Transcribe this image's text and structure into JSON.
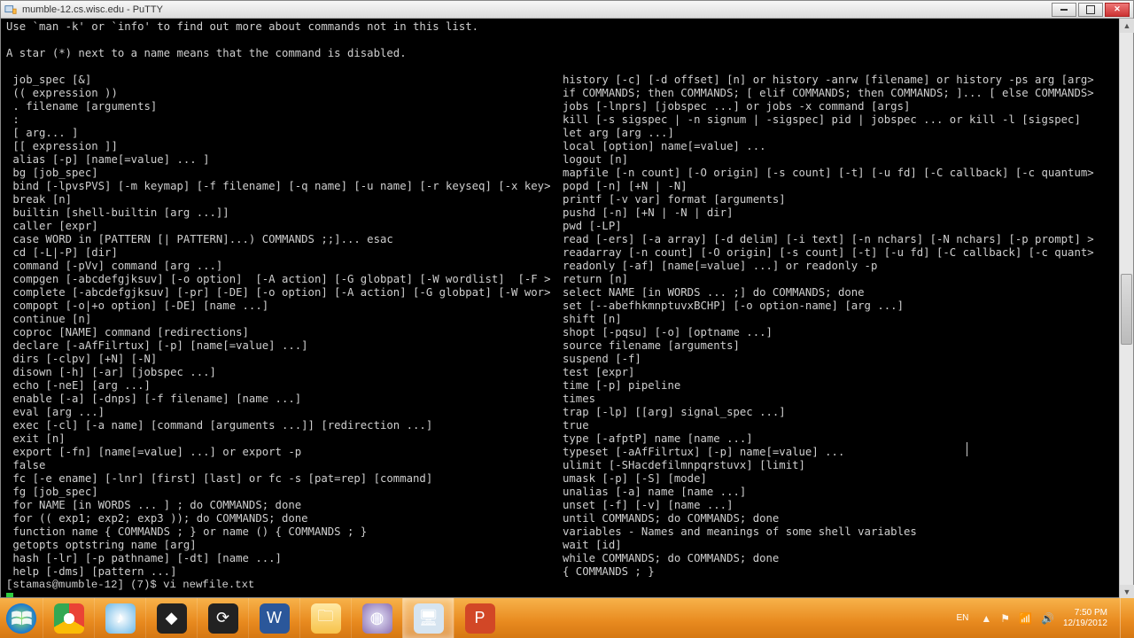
{
  "window": {
    "title": "mumble-12.cs.wisc.edu - PuTTY"
  },
  "terminal": {
    "intro": "Use `man -k' or `info' to find out more about commands not in this list.\n\nA star (*) next to a name means that the command is disabled.",
    "left_col": " job_spec [&]\n (( expression ))\n . filename [arguments]\n :\n [ arg... ]\n [[ expression ]]\n alias [-p] [name[=value] ... ]\n bg [job_spec]\n bind [-lpvsPVS] [-m keymap] [-f filename] [-q name] [-u name] [-r keyseq] [-x key>\n break [n]\n builtin [shell-builtin [arg ...]]\n caller [expr]\n case WORD in [PATTERN [| PATTERN]...) COMMANDS ;;]... esac\n cd [-L|-P] [dir]\n command [-pVv] command [arg ...]\n compgen [-abcdefgjksuv] [-o option]  [-A action] [-G globpat] [-W wordlist]  [-F >\n complete [-abcdefgjksuv] [-pr] [-DE] [-o option] [-A action] [-G globpat] [-W wor>\n compopt [-o|+o option] [-DE] [name ...]\n continue [n]\n coproc [NAME] command [redirections]\n declare [-aAfFilrtux] [-p] [name[=value] ...]\n dirs [-clpv] [+N] [-N]\n disown [-h] [-ar] [jobspec ...]\n echo [-neE] [arg ...]\n enable [-a] [-dnps] [-f filename] [name ...]\n eval [arg ...]\n exec [-cl] [-a name] [command [arguments ...]] [redirection ...]\n exit [n]\n export [-fn] [name[=value] ...] or export -p\n false\n fc [-e ename] [-lnr] [first] [last] or fc -s [pat=rep] [command]\n fg [job_spec]\n for NAME [in WORDS ... ] ; do COMMANDS; done\n for (( exp1; exp2; exp3 )); do COMMANDS; done\n function name { COMMANDS ; } or name () { COMMANDS ; }\n getopts optstring name [arg]\n hash [-lr] [-p pathname] [-dt] [name ...]\n help [-dms] [pattern ...]",
    "right_col": "history [-c] [-d offset] [n] or history -anrw [filename] or history -ps arg [arg>\nif COMMANDS; then COMMANDS; [ elif COMMANDS; then COMMANDS; ]... [ else COMMANDS>\njobs [-lnprs] [jobspec ...] or jobs -x command [args]\nkill [-s sigspec | -n signum | -sigspec] pid | jobspec ... or kill -l [sigspec]\nlet arg [arg ...]\nlocal [option] name[=value] ...\nlogout [n]\nmapfile [-n count] [-O origin] [-s count] [-t] [-u fd] [-C callback] [-c quantum>\npopd [-n] [+N | -N]\nprintf [-v var] format [arguments]\npushd [-n] [+N | -N | dir]\npwd [-LP]\nread [-ers] [-a array] [-d delim] [-i text] [-n nchars] [-N nchars] [-p prompt] >\nreadarray [-n count] [-O origin] [-s count] [-t] [-u fd] [-C callback] [-c quant>\nreadonly [-af] [name[=value] ...] or readonly -p\nreturn [n]\nselect NAME [in WORDS ... ;] do COMMANDS; done\nset [--abefhkmnptuvxBCHP] [-o option-name] [arg ...]\nshift [n]\nshopt [-pqsu] [-o] [optname ...]\nsource filename [arguments]\nsuspend [-f]\ntest [expr]\ntime [-p] pipeline\ntimes\ntrap [-lp] [[arg] signal_spec ...]\ntrue\ntype [-afptP] name [name ...]\ntypeset [-aAfFilrtux] [-p] name[=value] ...\nulimit [-SHacdefilmnpqrstuvx] [limit]\numask [-p] [-S] [mode]\nunalias [-a] name [name ...]\nunset [-f] [-v] [name ...]\nuntil COMMANDS; do COMMANDS; done\nvariables - Names and meanings of some shell variables\nwait [id]\nwhile COMMANDS; do COMMANDS; done\n{ COMMANDS ; }",
    "prompt": "[stamas@mumble-12] (7)$ vi newfile.txt"
  },
  "taskbar": {
    "apps": [
      {
        "name": "start",
        "label": "Start"
      },
      {
        "name": "chrome",
        "label": "Google Chrome"
      },
      {
        "name": "itunes",
        "label": "iTunes"
      },
      {
        "name": "app1",
        "label": "App"
      },
      {
        "name": "steam",
        "label": "Steam"
      },
      {
        "name": "word",
        "label": "Microsoft Word"
      },
      {
        "name": "explorer",
        "label": "File Explorer"
      },
      {
        "name": "eclipse",
        "label": "Eclipse"
      },
      {
        "name": "putty",
        "label": "PuTTY",
        "active": true
      },
      {
        "name": "powerpoint",
        "label": "PowerPoint"
      }
    ],
    "tray": {
      "lang": "EN",
      "time": "7:50 PM",
      "date": "12/19/2012"
    }
  }
}
